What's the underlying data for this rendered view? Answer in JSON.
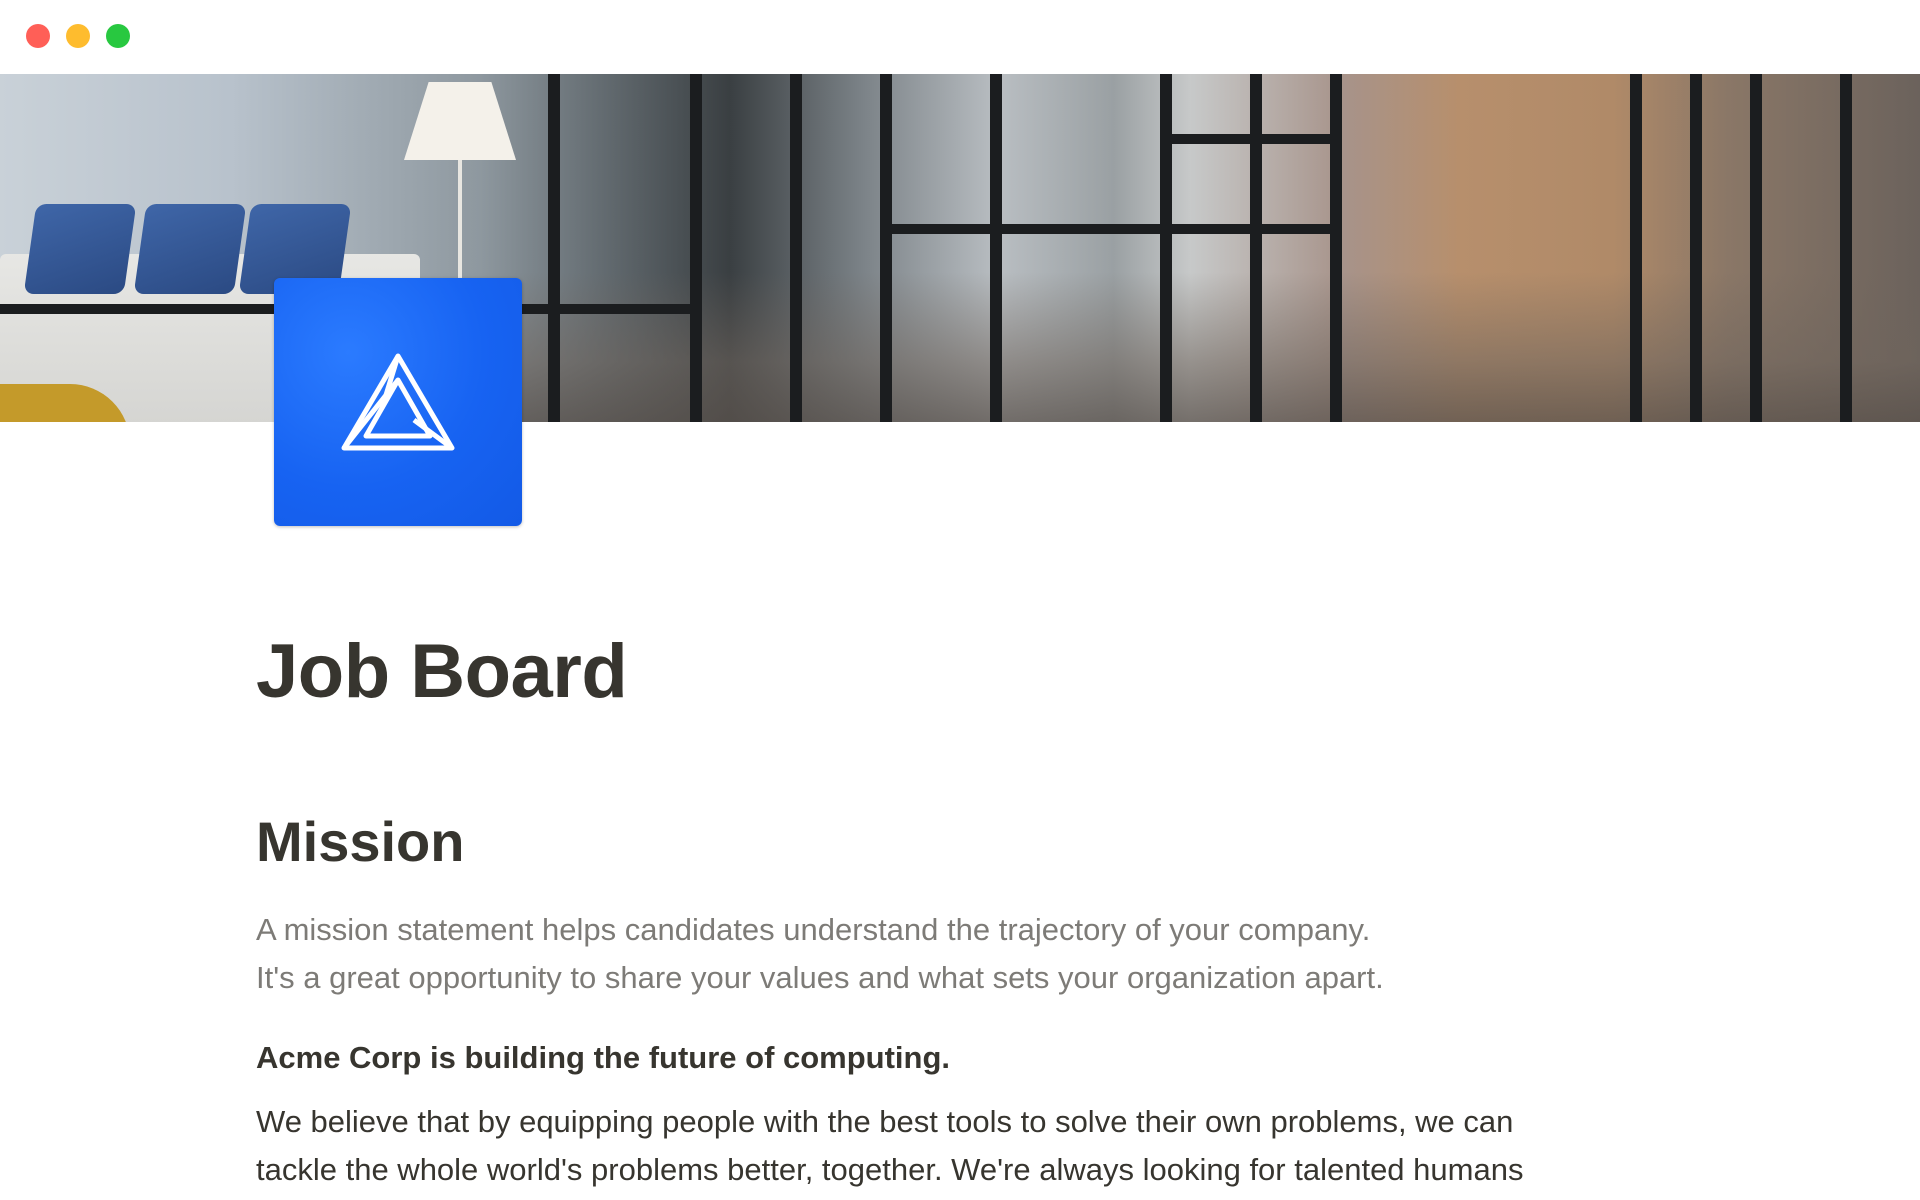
{
  "window": {
    "controls": [
      "close",
      "minimize",
      "zoom"
    ]
  },
  "cover": {
    "description_icon": "office-hallway-cover-image"
  },
  "page": {
    "icon": "impossible-triangle-icon",
    "icon_color": "#1763f2",
    "title": "Job Board"
  },
  "mission": {
    "heading": "Mission",
    "hint_line_1": "A mission statement helps candidates understand the trajectory of your company.",
    "hint_line_2": "It's a great opportunity to share your values and what sets your organization apart.",
    "bold_statement": "Acme Corp is building the future of computing.",
    "body_line_1": "We believe that by equipping people with the best tools to solve their own problems, we can",
    "body_line_2": "tackle the whole world's problems better, together. We're always looking for talented humans"
  },
  "colors": {
    "text_primary": "#37352f",
    "text_muted": "#7d7b77",
    "traffic_close": "#ff5f57",
    "traffic_minimize": "#febc2e",
    "traffic_zoom": "#28c840"
  }
}
